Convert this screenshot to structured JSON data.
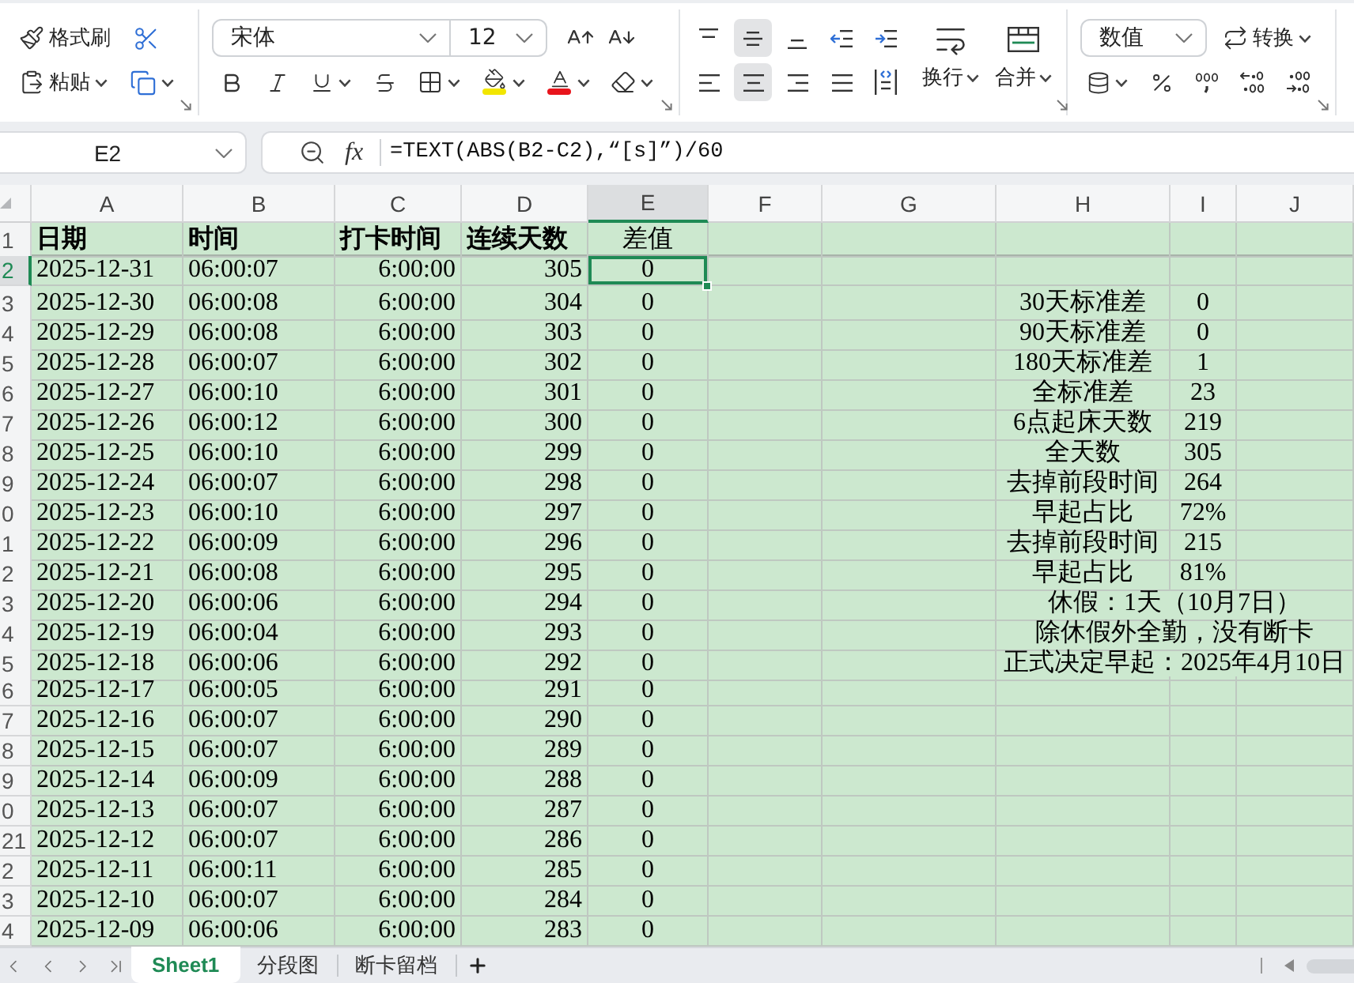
{
  "ribbon": {
    "clipboard": {
      "format_painter": "格式刷",
      "paste": "粘贴"
    },
    "font": {
      "name": "宋体",
      "size": "12"
    },
    "alignment": {
      "vertical": [
        {
          "kind": "top",
          "selected": false
        },
        {
          "kind": "middle",
          "selected": true
        },
        {
          "kind": "bottom",
          "selected": false
        }
      ],
      "horizontal": [
        {
          "kind": "left",
          "selected": false
        },
        {
          "kind": "center",
          "selected": true
        },
        {
          "kind": "right",
          "selected": false
        },
        {
          "kind": "justify",
          "selected": false
        },
        {
          "kind": "distributed",
          "selected": false
        }
      ],
      "wrap": "换行",
      "merge": "合并"
    },
    "number": {
      "format": "数值",
      "convert": "转换"
    }
  },
  "formula_bar": {
    "name_box": "E2",
    "function_button": "fx",
    "formula": "=TEXT(ABS(B2-C2),“[s]”)/60"
  },
  "columns": [
    {
      "label": "A",
      "selected": false
    },
    {
      "label": "B",
      "selected": false
    },
    {
      "label": "C",
      "selected": false
    },
    {
      "label": "D",
      "selected": false
    },
    {
      "label": "E",
      "selected": true
    },
    {
      "label": "F",
      "selected": false
    },
    {
      "label": "G",
      "selected": false
    },
    {
      "label": "H",
      "selected": false
    },
    {
      "label": "I",
      "selected": false
    },
    {
      "label": "J",
      "selected": false
    }
  ],
  "header_row": {
    "number": "1",
    "selected": false,
    "cells": [
      "日期",
      "时间",
      "打卡时间",
      "连续天数",
      "差值"
    ]
  },
  "rows": [
    {
      "number": "2",
      "selected": true,
      "cells": [
        "2025-12-31",
        "06:00:07",
        "6:00:00",
        "305",
        "0"
      ]
    },
    {
      "number": "3",
      "selected": false,
      "cells": [
        "2025-12-30",
        "06:00:08",
        "6:00:00",
        "304",
        "0"
      ],
      "notes": {
        "kind": "pair",
        "label": "30天标准差",
        "value": "0"
      }
    },
    {
      "number": "4",
      "selected": false,
      "cells": [
        "2025-12-29",
        "06:00:08",
        "6:00:00",
        "303",
        "0"
      ],
      "notes": {
        "kind": "pair",
        "label": "90天标准差",
        "value": "0"
      }
    },
    {
      "number": "5",
      "selected": false,
      "cells": [
        "2025-12-28",
        "06:00:07",
        "6:00:00",
        "302",
        "0"
      ],
      "notes": {
        "kind": "pair",
        "label": "180天标准差",
        "value": "1"
      }
    },
    {
      "number": "6",
      "selected": false,
      "cells": [
        "2025-12-27",
        "06:00:10",
        "6:00:00",
        "301",
        "0"
      ],
      "notes": {
        "kind": "pair",
        "label": "全标准差",
        "value": "23"
      }
    },
    {
      "number": "7",
      "selected": false,
      "cells": [
        "2025-12-26",
        "06:00:12",
        "6:00:00",
        "300",
        "0"
      ],
      "notes": {
        "kind": "pair",
        "label": "6点起床天数",
        "value": "219"
      }
    },
    {
      "number": "8",
      "selected": false,
      "cells": [
        "2025-12-25",
        "06:00:10",
        "6:00:00",
        "299",
        "0"
      ],
      "notes": {
        "kind": "pair",
        "label": "全天数",
        "value": "305"
      }
    },
    {
      "number": "9",
      "selected": false,
      "cells": [
        "2025-12-24",
        "06:00:07",
        "6:00:00",
        "298",
        "0"
      ],
      "notes": {
        "kind": "pair",
        "label": "去掉前段时间",
        "value": "264"
      }
    },
    {
      "number": "0",
      "selected": false,
      "cells": [
        "2025-12-23",
        "06:00:10",
        "6:00:00",
        "297",
        "0"
      ],
      "notes": {
        "kind": "pair",
        "label": "早起占比",
        "value": "72%"
      }
    },
    {
      "number": "1",
      "selected": false,
      "cells": [
        "2025-12-22",
        "06:00:09",
        "6:00:00",
        "296",
        "0"
      ],
      "notes": {
        "kind": "pair",
        "label": "去掉前段时间",
        "value": "215"
      }
    },
    {
      "number": "2",
      "selected": false,
      "cells": [
        "2025-12-21",
        "06:00:08",
        "6:00:00",
        "295",
        "0"
      ],
      "notes": {
        "kind": "pair",
        "label": "早起占比",
        "value": "81%"
      }
    },
    {
      "number": "3",
      "selected": false,
      "cells": [
        "2025-12-20",
        "06:00:06",
        "6:00:00",
        "294",
        "0"
      ],
      "notes": {
        "kind": "span",
        "text": "休假：1天（10月7日）"
      }
    },
    {
      "number": "4",
      "selected": false,
      "cells": [
        "2025-12-19",
        "06:00:04",
        "6:00:00",
        "293",
        "0"
      ],
      "notes": {
        "kind": "span",
        "text": "除休假外全勤，没有断卡"
      }
    },
    {
      "number": "5",
      "selected": false,
      "cells": [
        "2025-12-18",
        "06:00:06",
        "6:00:00",
        "292",
        "0"
      ],
      "notes": {
        "kind": "span",
        "text": "正式决定早起：2025年4月10日"
      }
    },
    {
      "number": "6",
      "selected": false,
      "cells": [
        "2025-12-17",
        "06:00:05",
        "6:00:00",
        "291",
        "0"
      ]
    },
    {
      "number": "7",
      "selected": false,
      "cells": [
        "2025-12-16",
        "06:00:07",
        "6:00:00",
        "290",
        "0"
      ]
    },
    {
      "number": "8",
      "selected": false,
      "cells": [
        "2025-12-15",
        "06:00:07",
        "6:00:00",
        "289",
        "0"
      ]
    },
    {
      "number": "9",
      "selected": false,
      "cells": [
        "2025-12-14",
        "06:00:09",
        "6:00:00",
        "288",
        "0"
      ]
    },
    {
      "number": "0",
      "selected": false,
      "cells": [
        "2025-12-13",
        "06:00:07",
        "6:00:00",
        "287",
        "0"
      ]
    },
    {
      "number": "21",
      "selected": false,
      "cells": [
        "2025-12-12",
        "06:00:07",
        "6:00:00",
        "286",
        "0"
      ]
    },
    {
      "number": "2",
      "selected": false,
      "cells": [
        "2025-12-11",
        "06:00:11",
        "6:00:00",
        "285",
        "0"
      ]
    },
    {
      "number": "3",
      "selected": false,
      "cells": [
        "2025-12-10",
        "06:00:07",
        "6:00:00",
        "284",
        "0"
      ]
    },
    {
      "number": "4",
      "selected": false,
      "cells": [
        "2025-12-09",
        "06:00:06",
        "6:00:00",
        "283",
        "0"
      ]
    }
  ],
  "sheet_tabs": [
    {
      "label": "Sheet1",
      "selected": true
    },
    {
      "label": "分段图",
      "selected": false
    },
    {
      "label": "断卡留档",
      "selected": false
    }
  ]
}
